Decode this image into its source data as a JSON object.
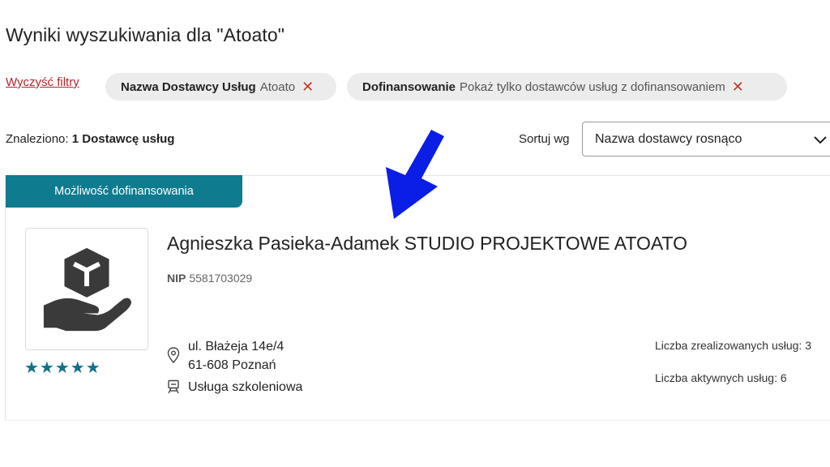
{
  "page": {
    "title": "Wyniki wyszukiwania dla \"Atoato\""
  },
  "filters": {
    "clear_label": "Wyczyść filtry",
    "chips": [
      {
        "key": "Nazwa Dostawcy Usług",
        "value": "Atoato",
        "remove": "✕"
      },
      {
        "key": "Dofinansowanie",
        "value": "Pokaż tylko dostawców usług z dofinansowaniem",
        "remove": "✕"
      }
    ]
  },
  "results": {
    "found_label": "Znaleziono:",
    "found_value": "1 Dostawcę usług",
    "sort_label": "Sortuj wg",
    "sort_value": "Nazwa dostawcy rosnąco"
  },
  "card": {
    "badge": "Możliwość dofinansowania",
    "name": "Agnieszka Pasieka-Adamek STUDIO PROJEKTOWE ATOATO",
    "nip_label": "NIP",
    "nip_value": "5581703029",
    "rating_stars": "★★★★★",
    "rating": 5,
    "address_line1": "ul. Błażeja 14e/4",
    "address_line2": "61-608 Poznań",
    "service_type": "Usługa szkoleniowa",
    "stat_completed": "Liczba zrealizowanych usług: 3",
    "stat_active": "Liczba aktywnych usług: 6",
    "logo_icon": "hand-holding-box-icon"
  },
  "annotation": {
    "icon": "blue-arrow-pointer",
    "color": "#0a1ee6"
  },
  "colors": {
    "accent": "#0f7b8f",
    "link": "#b3262d",
    "star": "#10718a"
  }
}
